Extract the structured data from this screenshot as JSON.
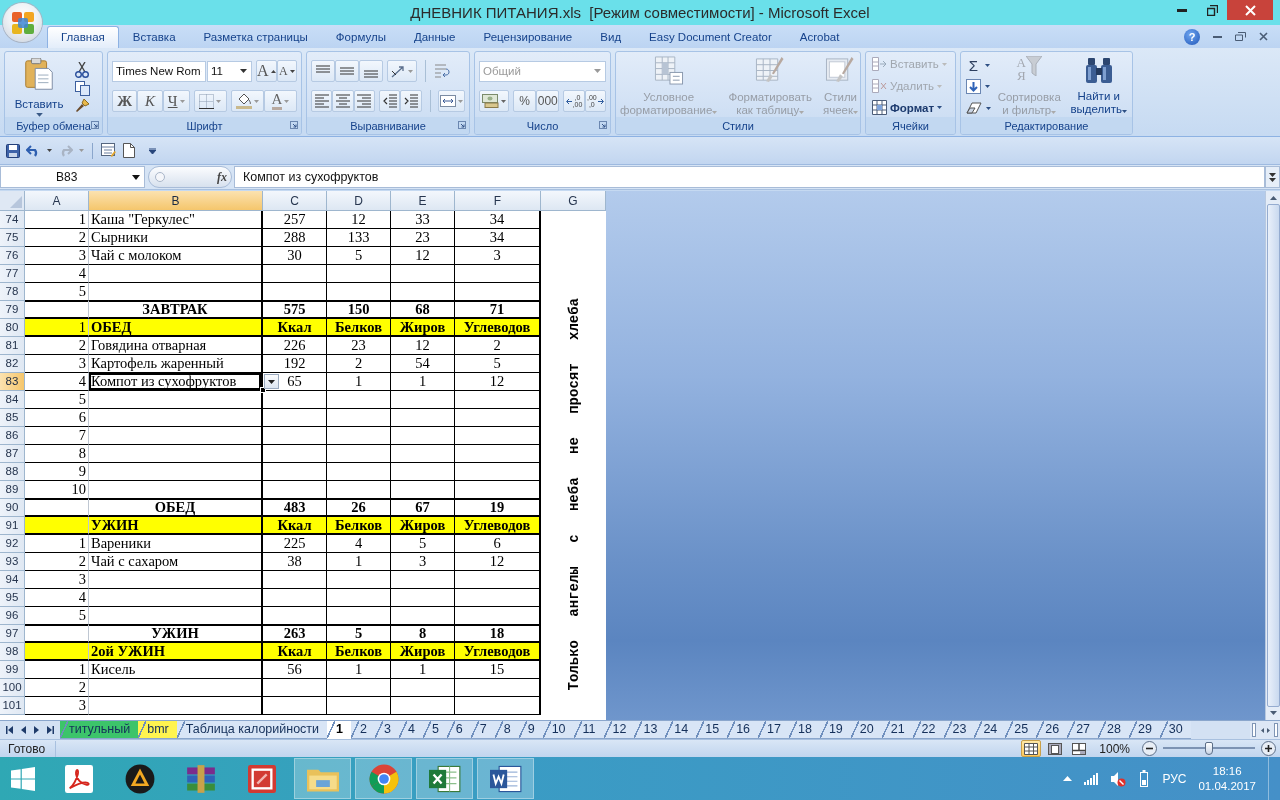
{
  "window": {
    "title": "ДНЕВНИК ПИТАНИЯ.xls  [Режим совместимости] - Microsoft Excel"
  },
  "ribbon_tabs": [
    {
      "label": "Главная",
      "selected": true
    },
    {
      "label": "Вставка",
      "selected": false
    },
    {
      "label": "Разметка страницы",
      "selected": false
    },
    {
      "label": "Формулы",
      "selected": false
    },
    {
      "label": "Данные",
      "selected": false
    },
    {
      "label": "Рецензирование",
      "selected": false
    },
    {
      "label": "Вид",
      "selected": false
    },
    {
      "label": "Easy Document Creator",
      "selected": false
    },
    {
      "label": "Acrobat",
      "selected": false
    }
  ],
  "help": "?",
  "clipboard": {
    "label": "Буфер обмена",
    "paste": "Вставить"
  },
  "font": {
    "label": "Шрифт",
    "name": "Times New Rom",
    "size": "11",
    "grow": "A",
    "shrink": "A",
    "bold": "Ж",
    "italic": "К",
    "underline": "Ч",
    "color_letter": "A"
  },
  "alignment": {
    "label": "Выравнивание"
  },
  "number": {
    "label": "Число",
    "format": {
      "value": "Общий",
      "disabled": true
    },
    "percent": "%",
    "thousands": "000",
    "more_decimals": ",0\n,00",
    "fewer_decimals": ",00\n,0"
  },
  "styles": {
    "label": "Стили",
    "buttons": [
      {
        "kind": "conditional",
        "label": "Условное\nформатирование",
        "disabled": true
      },
      {
        "kind": "table",
        "label": "Форматировать\nкак таблицу",
        "disabled": true
      },
      {
        "kind": "cell",
        "label": "Стили\nячеек",
        "disabled": true
      }
    ]
  },
  "cells": {
    "label": "Ячейки",
    "buttons": [
      {
        "kind": "insert",
        "label": "Вставить",
        "disabled": true
      },
      {
        "kind": "delete",
        "label": "Удалить",
        "disabled": true
      },
      {
        "kind": "format",
        "label": "Формат",
        "disabled": false
      }
    ]
  },
  "editing": {
    "label": "Редактирование",
    "sum": "Σ",
    "sort": {
      "letters": "А\nЯ",
      "label": "Сортировка\nи фильтр",
      "disabled": true
    },
    "find": {
      "label": "Найти и\nвыделить",
      "disabled": false
    }
  },
  "formula_bar": {
    "name_box": "B83",
    "function_label": "fx",
    "formula": "Компот из сухофруктов"
  },
  "sheet": {
    "columns": [
      {
        "label": "A",
        "selected": false
      },
      {
        "label": "B",
        "selected": true
      },
      {
        "label": "C",
        "selected": false
      },
      {
        "label": "D",
        "selected": false
      },
      {
        "label": "E",
        "selected": false
      },
      {
        "label": "F",
        "selected": false
      },
      {
        "label": "G",
        "selected": false
      }
    ],
    "active_cell_dropdown": true,
    "rows": [
      {
        "number": "74",
        "kind": "item",
        "selected": false,
        "cells": {
          "a": "1",
          "b": "Каша \"Геркулес\"",
          "c": "257",
          "d": "12",
          "e": "33",
          "f": "34"
        }
      },
      {
        "number": "75",
        "kind": "item",
        "selected": false,
        "cells": {
          "a": "2",
          "b": "Сырники",
          "c": "288",
          "d": "133",
          "e": "23",
          "f": "34"
        }
      },
      {
        "number": "76",
        "kind": "item",
        "selected": false,
        "cells": {
          "a": "3",
          "b": "Чай с молоком",
          "c": "30",
          "d": "5",
          "e": "12",
          "f": "3"
        }
      },
      {
        "number": "77",
        "kind": "item",
        "selected": false,
        "cells": {
          "a": "4"
        }
      },
      {
        "number": "78",
        "kind": "item",
        "selected": false,
        "cells": {
          "a": "5"
        }
      },
      {
        "number": "79",
        "kind": "total",
        "selected": false,
        "cells": {
          "b": "ЗАВТРАК",
          "c": "575",
          "d": "150",
          "e": "68",
          "f": "71"
        }
      },
      {
        "number": "80",
        "kind": "header",
        "selected": false,
        "cells": {
          "a": "1",
          "b": "ОБЕД",
          "c": "Ккал",
          "d": "Белков",
          "e": "Жиров",
          "f": "Углеводов"
        }
      },
      {
        "number": "81",
        "kind": "item",
        "selected": false,
        "cells": {
          "a": "2",
          "b": "Говядина отварная",
          "c": "226",
          "d": "23",
          "e": "12",
          "f": "2"
        }
      },
      {
        "number": "82",
        "kind": "item",
        "selected": false,
        "cells": {
          "a": "3",
          "b": "Картофель жаренный",
          "c": "192",
          "d": "2",
          "e": "54",
          "f": "5"
        }
      },
      {
        "number": "83",
        "kind": "item",
        "selected": true,
        "cells": {
          "a": "4",
          "b": "Компот из сухофруктов",
          "c": "65",
          "d": "1",
          "e": "1",
          "f": "12"
        }
      },
      {
        "number": "84",
        "kind": "item",
        "selected": false,
        "cells": {
          "a": "5"
        }
      },
      {
        "number": "85",
        "kind": "item",
        "selected": false,
        "cells": {
          "a": "6"
        }
      },
      {
        "number": "86",
        "kind": "item",
        "selected": false,
        "cells": {
          "a": "7"
        }
      },
      {
        "number": "87",
        "kind": "item",
        "selected": false,
        "cells": {
          "a": "8"
        }
      },
      {
        "number": "88",
        "kind": "item",
        "selected": false,
        "cells": {
          "a": "9"
        }
      },
      {
        "number": "89",
        "kind": "item",
        "selected": false,
        "cells": {
          "a": "10"
        }
      },
      {
        "number": "90",
        "kind": "total",
        "selected": false,
        "cells": {
          "b": "ОБЕД",
          "c": "483",
          "d": "26",
          "e": "67",
          "f": "19"
        }
      },
      {
        "number": "91",
        "kind": "header",
        "selected": false,
        "cells": {
          "b": "УЖИН",
          "c": "Ккал",
          "d": "Белков",
          "e": "Жиров",
          "f": "Углеводов"
        }
      },
      {
        "number": "92",
        "kind": "item",
        "selected": false,
        "cells": {
          "a": "1",
          "b": "Вареники",
          "c": "225",
          "d": "4",
          "e": "5",
          "f": "6"
        }
      },
      {
        "number": "93",
        "kind": "item",
        "selected": false,
        "cells": {
          "a": "2",
          "b": "Чай с сахаром",
          "c": "38",
          "d": "1",
          "e": "3",
          "f": "12"
        }
      },
      {
        "number": "94",
        "kind": "item",
        "selected": false,
        "cells": {
          "a": "3"
        }
      },
      {
        "number": "95",
        "kind": "item",
        "selected": false,
        "cells": {
          "a": "4"
        }
      },
      {
        "number": "96",
        "kind": "item",
        "selected": false,
        "cells": {
          "a": "5"
        }
      },
      {
        "number": "97",
        "kind": "total",
        "selected": false,
        "cells": {
          "b": "УЖИН",
          "c": "263",
          "d": "5",
          "e": "8",
          "f": "18"
        }
      },
      {
        "number": "98",
        "kind": "header",
        "selected": false,
        "cells": {
          "b": "2ой УЖИН",
          "c": "Ккал",
          "d": "Белков",
          "e": "Жиров",
          "f": "Углеводов"
        }
      },
      {
        "number": "99",
        "kind": "item",
        "selected": false,
        "cells": {
          "a": "1",
          "b": "Кисель",
          "c": "56",
          "d": "1",
          "e": "1",
          "f": "15"
        }
      },
      {
        "number": "100",
        "kind": "item",
        "selected": false,
        "cells": {
          "a": "2"
        }
      },
      {
        "number": "101",
        "kind": "item",
        "selected": false,
        "cells": {
          "a": "3"
        }
      }
    ],
    "note": "Только ангелы с неба не просят хлеба"
  },
  "sheet_tabs": [
    {
      "label": "титульный",
      "selected": false,
      "color": "#3cc46a"
    },
    {
      "label": "bmr",
      "selected": false,
      "color": "#fff44f"
    },
    {
      "label": "Таблица калорийности",
      "selected": false
    },
    {
      "label": "1",
      "selected": true
    },
    {
      "label": "2",
      "selected": false
    },
    {
      "label": "3",
      "selected": false
    },
    {
      "label": "4",
      "selected": false
    },
    {
      "label": "5",
      "selected": false
    },
    {
      "label": "6",
      "selected": false
    },
    {
      "label": "7",
      "selected": false
    },
    {
      "label": "8",
      "selected": false
    },
    {
      "label": "9",
      "selected": false
    },
    {
      "label": "10",
      "selected": false
    },
    {
      "label": "11",
      "selected": false
    },
    {
      "label": "12",
      "selected": false
    },
    {
      "label": "13",
      "selected": false
    },
    {
      "label": "14",
      "selected": false
    },
    {
      "label": "15",
      "selected": false
    },
    {
      "label": "16",
      "selected": false
    },
    {
      "label": "17",
      "selected": false
    },
    {
      "label": "18",
      "selected": false
    },
    {
      "label": "19",
      "selected": false
    },
    {
      "label": "20",
      "selected": false
    },
    {
      "label": "21",
      "selected": false
    },
    {
      "label": "22",
      "selected": false
    },
    {
      "label": "23",
      "selected": false
    },
    {
      "label": "24",
      "selected": false
    },
    {
      "label": "25",
      "selected": false
    },
    {
      "label": "26",
      "selected": false
    },
    {
      "label": "27",
      "selected": false
    },
    {
      "label": "28",
      "selected": false
    },
    {
      "label": "29",
      "selected": false
    },
    {
      "label": "30",
      "selected": false
    }
  ],
  "status_bar": {
    "status": "Готово",
    "views": [
      {
        "kind": "normal",
        "selected": true
      },
      {
        "kind": "layout",
        "selected": false
      },
      {
        "kind": "breaks",
        "selected": false
      }
    ],
    "zoom": "100%",
    "zoom_slider": {
      "level": 0.5
    }
  },
  "taskbar": {
    "apps": [
      {
        "kind": "pdf",
        "running": false
      },
      {
        "kind": "player",
        "running": false
      },
      {
        "kind": "archive",
        "running": false
      },
      {
        "kind": "presenter",
        "running": false
      },
      {
        "kind": "files",
        "running": true
      },
      {
        "kind": "browser",
        "running": true
      },
      {
        "kind": "spreadsheet",
        "running": true
      },
      {
        "kind": "document",
        "running": true
      }
    ],
    "tray": {
      "language": "РУС",
      "time": "18:16",
      "date": "01.04.2017"
    }
  }
}
